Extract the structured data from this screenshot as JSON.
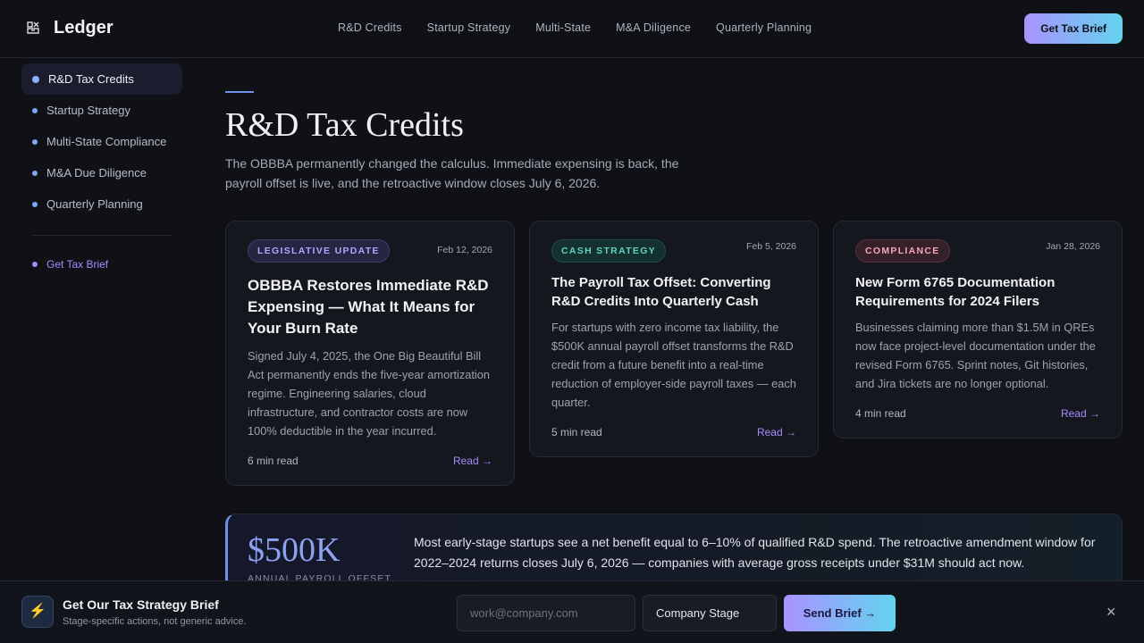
{
  "header": {
    "brand_icon": "scales-icon",
    "brand": "Ledger",
    "nav": [
      "R&D Credits",
      "Startup Strategy",
      "Multi-State",
      "M&A Diligence",
      "Quarterly Planning"
    ],
    "cta": "Get Tax Brief"
  },
  "sidebar": {
    "items": [
      {
        "label": "R&D Tax Credits",
        "active": true
      },
      {
        "label": "Startup Strategy",
        "active": false
      },
      {
        "label": "Multi-State Compliance",
        "active": false
      },
      {
        "label": "M&A Due Diligence",
        "active": false
      },
      {
        "label": "Quarterly Planning",
        "active": false
      }
    ],
    "cta": "Get Tax Brief"
  },
  "main": {
    "title": "R&D Tax Credits",
    "description": "The OBBBA permanently changed the calculus. Immediate expensing is back, the payroll offset is live, and the retroactive window closes July 6, 2026.",
    "cards": [
      {
        "badge": "LEGISLATIVE UPDATE",
        "date": "Feb 12, 2026",
        "title": "OBBBA Restores Immediate R&D Expensing — What It Means for Your Burn Rate",
        "body": "Signed July 4, 2025, the One Big Beautiful Bill Act permanently ends the five-year amortization regime. Engineering salaries, cloud infrastructure, and contractor costs are now 100% deductible in the year incurred.",
        "read_time": "6 min read",
        "read": "Read →"
      },
      {
        "badge": "CASH STRATEGY",
        "date": "Feb 5, 2026",
        "title": "The Payroll Tax Offset: Converting R&D Credits Into Quarterly Cash",
        "body": "For startups with zero income tax liability, the $500K annual payroll offset transforms the R&D credit from a future benefit into a real-time reduction of employer-side payroll taxes — each quarter.",
        "read_time": "5 min read",
        "read": "Read →"
      },
      {
        "badge": "COMPLIANCE",
        "date": "Jan 28, 2026",
        "title": "New Form 6765 Documentation Requirements for 2024 Filers",
        "body": "Businesses claiming more than $1.5M in QREs now face project-level documentation under the revised Form 6765. Sprint notes, Git histories, and Jira tickets are no longer optional.",
        "read_time": "4 min read",
        "read": "Read →"
      }
    ],
    "stat": {
      "value": "$500K",
      "label": "ANNUAL PAYROLL OFFSET",
      "text": "Most early-stage startups see a net benefit equal to 6–10% of qualified R&D spend. The retroactive amendment window for 2022–2024 returns closes July 6, 2026 — companies with average gross receipts under $31M should act now."
    }
  },
  "bottom_bar": {
    "title": "Get Our Tax Strategy Brief",
    "subtitle": "Stage-specific actions, not generic advice.",
    "email_placeholder": "work@company.com",
    "stage": "Company Stage",
    "send": "Send Brief →",
    "close": "×"
  }
}
